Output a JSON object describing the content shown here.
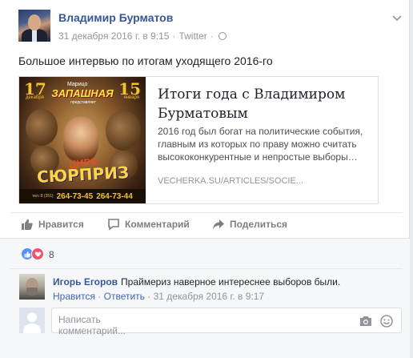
{
  "post": {
    "author": "Владимир Бурматов",
    "timestamp": "31 декабря 2016 г. в 9:15",
    "separator": "·",
    "source": "Twitter",
    "privacy_icon": "globe-icon",
    "menu_icon": "chevron-down-icon",
    "text": "Большое интервью по итогам уходящего 2016-го"
  },
  "link_card": {
    "title": "Итоги года с Владимиром Бурматовым",
    "description": "2016 год был богат на политические события, главным из которых по праву можно считать высококонкурентные и непростые выборы…",
    "domain": "VECHERKA.SU/ARTICLES/SOCIE...",
    "image": {
      "date_left": "17",
      "month_left": "декабря",
      "date_right": "15",
      "month_right": "января",
      "top_small": "Марицо",
      "title": "ЗАПАШНАЯ",
      "subtitle": "представляет",
      "circus": "ЦИРК",
      "surprise": "СЮРПРИЗ",
      "tel": "тел.:8 (351)",
      "phone1": "264-73-45",
      "phone2": "264-73-44"
    }
  },
  "actions": {
    "like": "Нравится",
    "comment": "Комментарий",
    "share": "Поделиться"
  },
  "reactions": {
    "count": "8",
    "like_color": "#5890ff",
    "love_color": "#f25268"
  },
  "comment": {
    "author": "Игорь Егоров",
    "text": "Праймериз наверное интереснее выборов были.",
    "like_link": "Нравится",
    "reply_link": "Ответить",
    "dot": "·",
    "time": "31 декабря 2016 г. в 9:17"
  },
  "reply": {
    "placeholder": "Написать комментарий..."
  },
  "colors": {
    "link": "#365899",
    "meta": "#90949c",
    "background": "#e9ebee"
  }
}
